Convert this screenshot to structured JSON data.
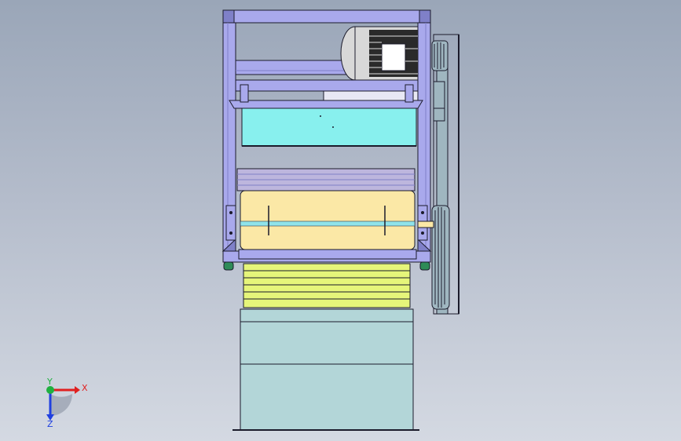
{
  "viewport": {
    "background_top": "#9aa6b8",
    "background_bottom": "#d4d9e2"
  },
  "model": {
    "view": "front",
    "colors": {
      "frame": "#a9a9ec",
      "frame_dark": "#7f80c8",
      "hopper": "#88f0ee",
      "roller": "#fbe8a6",
      "roller_band": "#8fe3ea",
      "grille": "#e6f57a",
      "base": "#b3d6d8",
      "pulley": "#9fb6c0",
      "motor_body": "#d8d8d8",
      "motor_fins": "#2a2a2a",
      "feet": "#2e8b57",
      "outline": "#1b1b2b"
    }
  },
  "triad": {
    "x_label": "X",
    "y_label": "Y",
    "z_label": "Z",
    "x_color": "#e02020",
    "y_color": "#20b040",
    "z_color": "#2040e0"
  }
}
